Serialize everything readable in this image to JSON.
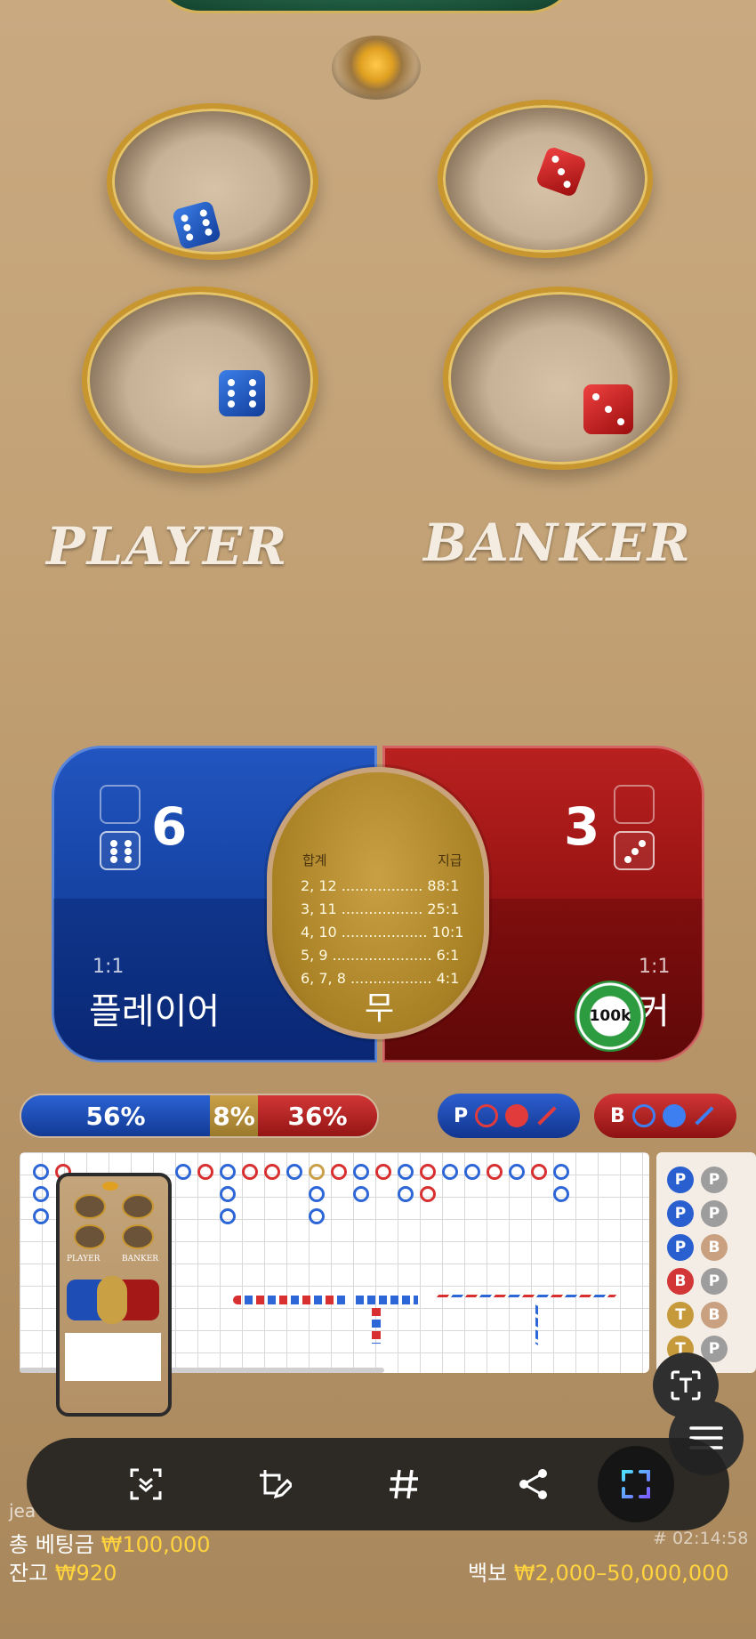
{
  "table": {
    "player_label": "PLAYER",
    "banker_label": "BANKER"
  },
  "bets": {
    "player": {
      "score": "6",
      "odds": "1:1",
      "name": "플레이어"
    },
    "banker": {
      "score": "3",
      "odds": "1:1",
      "name": "커"
    },
    "tie": {
      "header_left": "합계",
      "header_right": "지급",
      "rows": [
        "2, 12 .................. 88:1",
        "3, 11 .................. 25:1",
        "4, 10 ................... 10:1",
        "5, 9 ...................... 6:1",
        "6, 7, 8 .................. 4:1"
      ],
      "name": "무"
    },
    "chip_label": "100k"
  },
  "stats": {
    "player_pct": "56%",
    "tie_pct": "8%",
    "banker_pct": "36%"
  },
  "predict": {
    "player_letter": "P",
    "banker_letter": "B"
  },
  "side_road": [
    "P",
    "P",
    "P",
    "P",
    "P",
    "B",
    "B",
    "P",
    "T",
    "B",
    "T",
    "P"
  ],
  "footer": {
    "user": "jea",
    "total_bet_label": "총 베팅금",
    "total_bet_value": "₩100,000",
    "balance_label": "잔고",
    "balance_value": "₩920",
    "round_id": "# 02:14:58",
    "limits_label": "백보",
    "limits_value": "₩2,000–50,000,000"
  },
  "thumbnail": {
    "player_label": "PLAYER",
    "banker_label": "BANKER"
  }
}
